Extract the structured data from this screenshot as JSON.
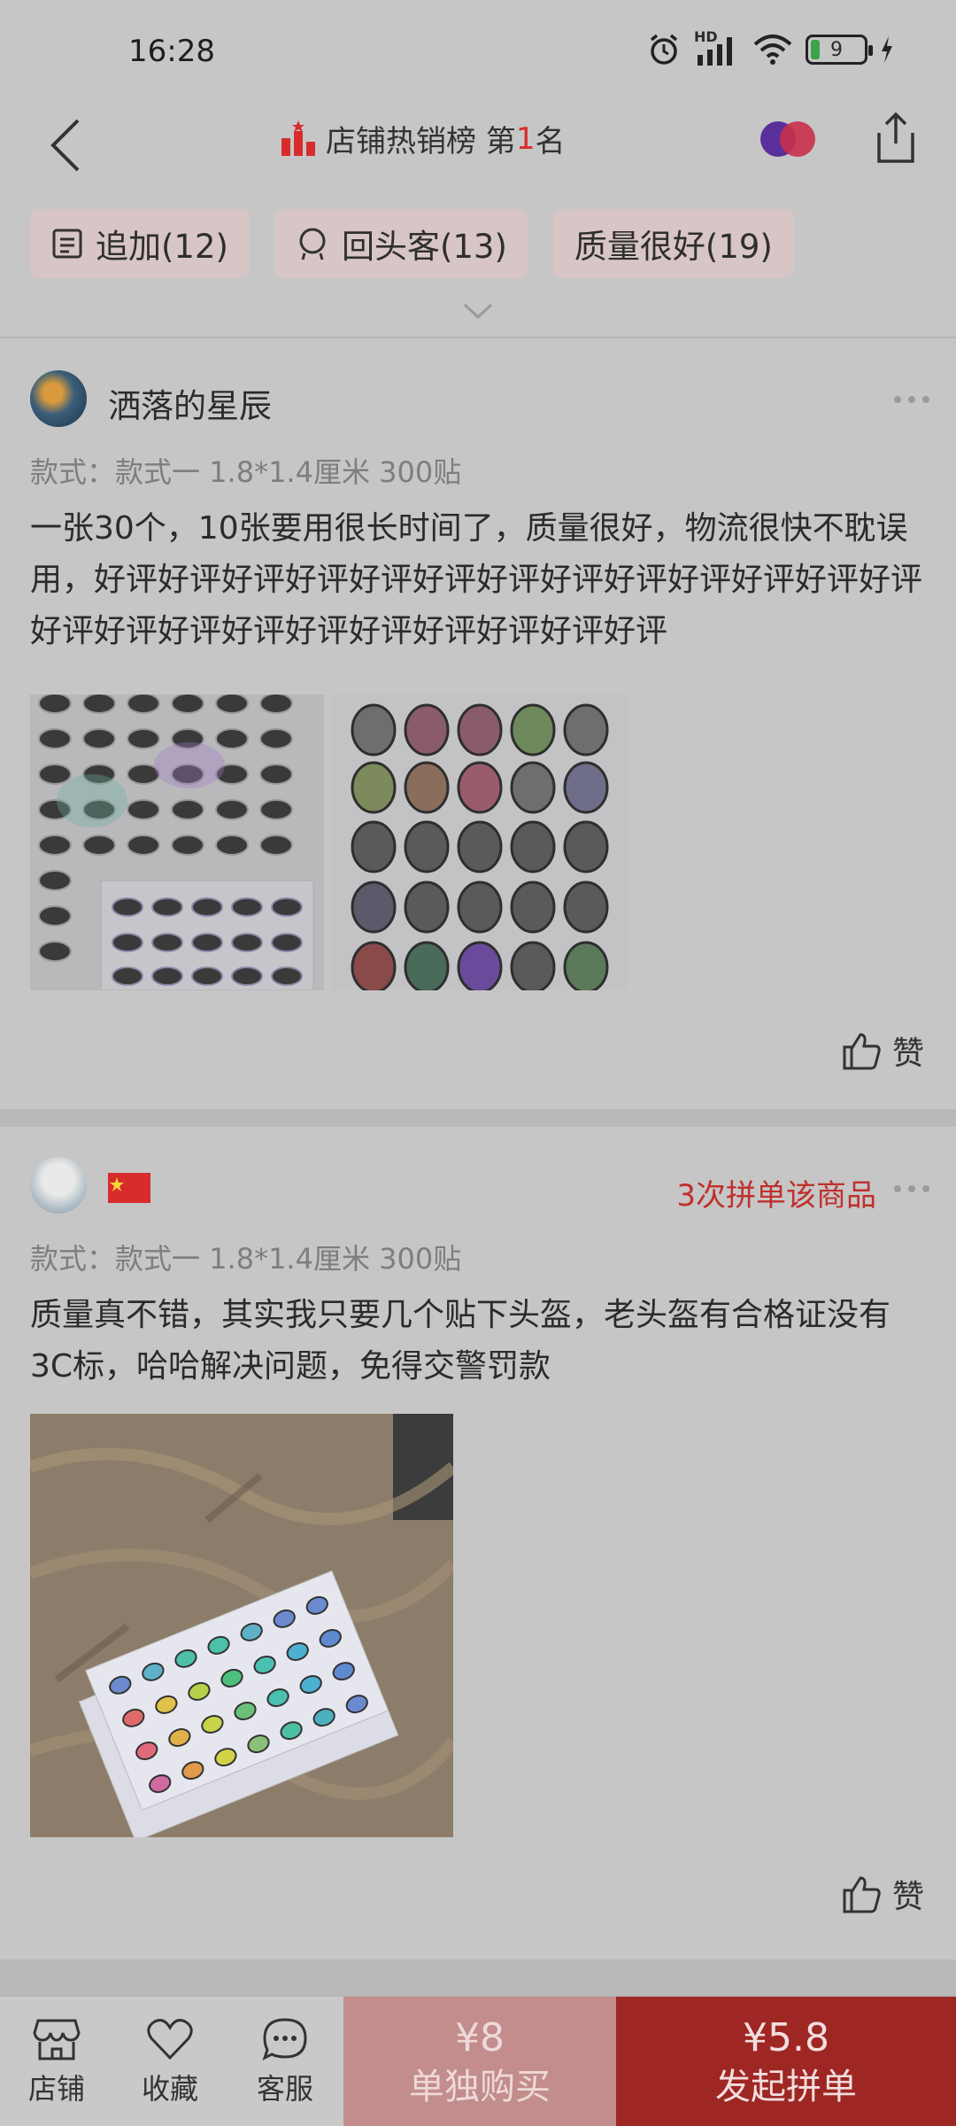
{
  "status_bar": {
    "time": "16:28",
    "network_label": "HD",
    "battery_level": "9"
  },
  "header": {
    "title_prefix": "店铺热销榜 第",
    "rank_number": "1",
    "title_suffix": "名",
    "back_icon": "chevron-left-icon",
    "share_icon": "share-icon"
  },
  "filter_chips": [
    {
      "label": "追加(12)",
      "icon": "note-icon"
    },
    {
      "label": "回头客(13)",
      "icon": "repeat-customer-icon"
    },
    {
      "label": "质量很好(19)",
      "icon": ""
    }
  ],
  "reviews": [
    {
      "username": "洒落的星辰",
      "variant": "款式：款式一 1.8*1.4厘米 300贴",
      "content": "一张30个，10张要用很长时间了，质量很好，物流很快不耽误用，好评好评好评好评好评好评好评好评好评好评好评好评好评好评好评好评好评好评好评好评好评好评好评",
      "photos": 2,
      "like_label": "赞"
    },
    {
      "username": "",
      "badge": "3次拼单该商品",
      "variant": "款式：款式一 1.8*1.4厘米 300贴",
      "content": "质量真不错，其实我只要几个贴下头盔，老头盔有合格证没有3C标，哈哈解决问题，免得交警罚款",
      "photos": 1,
      "like_label": "赞"
    }
  ],
  "bottom_bar": {
    "store_label": "店铺",
    "favorite_label": "收藏",
    "service_label": "客服",
    "single_price": "¥8",
    "single_label": "单独购买",
    "group_price": "¥5.8",
    "group_label": "发起拼单"
  },
  "colors": {
    "accent_red": "#d82c2c",
    "group_button": "#9e2623",
    "single_button": "#c28d8c"
  }
}
